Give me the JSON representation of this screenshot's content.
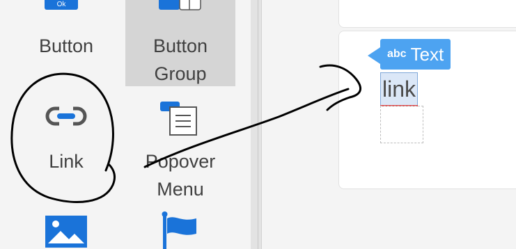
{
  "palette": {
    "items": [
      {
        "label": "Button",
        "icon": "button-icon"
      },
      {
        "label_line1": "Button",
        "label_line2": "Group",
        "icon": "button-group-icon",
        "selected": true
      },
      {
        "label": "Link",
        "icon": "link-icon"
      },
      {
        "label_line1": "Popover",
        "label_line2": "Menu",
        "icon": "popover-menu-icon"
      },
      {
        "label": "",
        "icon": "image-icon"
      },
      {
        "label": "",
        "icon": "flag-icon"
      }
    ]
  },
  "canvas": {
    "tooltip": {
      "abc": "abc",
      "label": "Text"
    },
    "selected_element_text": "link"
  },
  "colors": {
    "accent": "#4da3f1",
    "icon_blue": "#1a73d9",
    "selection_bg": "#d5d5d5",
    "annotation_ink": "#000000"
  }
}
